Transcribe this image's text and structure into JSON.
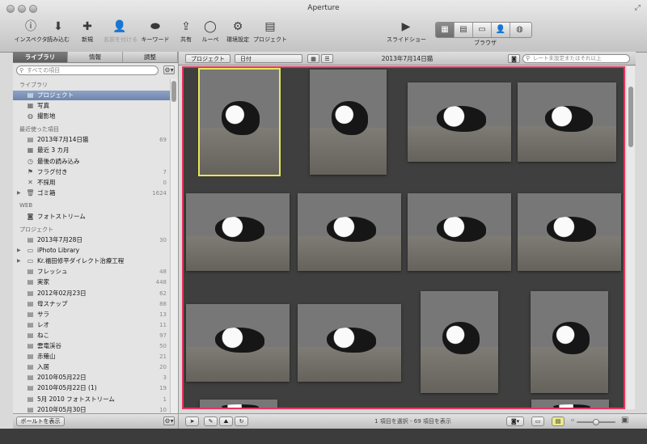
{
  "window": {
    "title": "Aperture"
  },
  "toolbar": {
    "left": [
      {
        "label": "インスペクタ",
        "icon": "inspector-icon",
        "glyph": "ⓘ"
      },
      {
        "label": "読み込む",
        "icon": "import-icon",
        "glyph": "⬇"
      },
      {
        "label": "新規",
        "icon": "new-icon",
        "glyph": "✚"
      },
      {
        "label": "名前を付ける",
        "icon": "name-faces-icon",
        "glyph": "👤"
      },
      {
        "label": "キーワード",
        "icon": "keyword-icon",
        "glyph": "⬬"
      },
      {
        "label": "共有",
        "icon": "share-icon",
        "glyph": "⇪"
      },
      {
        "label": "ルーペ",
        "icon": "loupe-icon",
        "glyph": "◯"
      },
      {
        "label": "環境設定",
        "icon": "adjust-icon",
        "glyph": "⚙"
      },
      {
        "label": "プロジェクト",
        "icon": "project-icon",
        "glyph": "▤"
      }
    ],
    "slideshow": {
      "label": "スライドショー",
      "icon": "slideshow-icon",
      "glyph": "▶"
    },
    "browser_label": "ブラウザ",
    "view_modes": [
      {
        "icon": "grid-view-icon",
        "glyph": "▦",
        "active": true
      },
      {
        "icon": "split-view-icon",
        "glyph": "▤",
        "active": false
      },
      {
        "icon": "viewer-icon",
        "glyph": "▭",
        "active": false
      },
      {
        "icon": "faces-view-icon",
        "glyph": "👤",
        "active": false
      },
      {
        "icon": "places-view-icon",
        "glyph": "◍",
        "active": false
      }
    ]
  },
  "sidebar": {
    "tabs": [
      {
        "label": "ライブラリ",
        "active": true
      },
      {
        "label": "情報",
        "active": false
      },
      {
        "label": "調整",
        "active": false
      }
    ],
    "search_placeholder": "すべての項目",
    "gear_glyph": "⚙▾",
    "sections": [
      {
        "header": "ライブラリ",
        "items": [
          {
            "label": "プロジェクト",
            "icon": "projects-icon",
            "glyph": "▤",
            "selected": true
          },
          {
            "label": "写真",
            "icon": "photos-icon",
            "glyph": "▦"
          },
          {
            "label": "撮影地",
            "icon": "places-icon",
            "glyph": "◍"
          }
        ]
      },
      {
        "header": "最近使った項目",
        "items": [
          {
            "label": "2013年7月14日猫",
            "icon": "project-item-icon",
            "glyph": "▤",
            "count": "69"
          },
          {
            "label": "最近 3 カ月",
            "icon": "calendar-icon",
            "glyph": "▦"
          },
          {
            "label": "最後の読み込み",
            "icon": "last-import-icon",
            "glyph": "◷"
          },
          {
            "label": "フラグ付き",
            "icon": "flag-icon",
            "glyph": "⚑",
            "count": "7"
          },
          {
            "label": "不採用",
            "icon": "reject-icon",
            "glyph": "✕",
            "count": "0"
          },
          {
            "label": "ゴミ箱",
            "icon": "trash-icon",
            "glyph": "🗑",
            "count": "1624",
            "disclosure": "▶"
          }
        ]
      },
      {
        "header": "WEB",
        "items": [
          {
            "label": "フォトストリーム",
            "icon": "photostream-icon",
            "glyph": "◙"
          }
        ]
      },
      {
        "header": "プロジェクト",
        "items": [
          {
            "label": "2013年7月28日",
            "icon": "project-item-icon",
            "glyph": "▤",
            "count": "30"
          },
          {
            "label": "iPhoto Library",
            "icon": "folder-icon",
            "glyph": "▭",
            "disclosure": "▶"
          },
          {
            "label": "Kr.福田修平ダイレクト治療工程",
            "icon": "folder-icon",
            "glyph": "▭",
            "disclosure": "▶"
          },
          {
            "label": "フレッシュ",
            "icon": "project-item-icon",
            "glyph": "▤",
            "count": "48"
          },
          {
            "label": "実家",
            "icon": "project-item-icon",
            "glyph": "▤",
            "count": "448"
          },
          {
            "label": "2012年02月23日",
            "icon": "project-item-icon",
            "glyph": "▤",
            "count": "62"
          },
          {
            "label": "母スナップ",
            "icon": "project-item-icon",
            "glyph": "▤",
            "count": "88"
          },
          {
            "label": "サラ",
            "icon": "project-item-icon",
            "glyph": "▤",
            "count": "13"
          },
          {
            "label": "レオ",
            "icon": "project-item-icon",
            "glyph": "▤",
            "count": "11"
          },
          {
            "label": "ねこ",
            "icon": "project-item-icon",
            "glyph": "▤",
            "count": "97"
          },
          {
            "label": "雲竜渓谷",
            "icon": "project-item-icon",
            "glyph": "▤",
            "count": "50"
          },
          {
            "label": "赤薙山",
            "icon": "project-item-icon",
            "glyph": "▤",
            "count": "21"
          },
          {
            "label": "入居",
            "icon": "project-item-icon",
            "glyph": "▤",
            "count": "20"
          },
          {
            "label": "2010年05月22日",
            "icon": "project-item-icon",
            "glyph": "▤",
            "count": "3"
          },
          {
            "label": "2010年05月22日 (1)",
            "icon": "project-item-icon",
            "glyph": "▤",
            "count": "19"
          },
          {
            "label": "5月 2010 フォトストリーム",
            "icon": "project-item-icon",
            "glyph": "▤",
            "count": "1"
          },
          {
            "label": "2010年05月30日",
            "icon": "project-item-icon",
            "glyph": "▤",
            "count": "10"
          }
        ]
      }
    ],
    "show_ports_button": "ボールトを表示"
  },
  "browser": {
    "sort_popup": "プロジェクト",
    "date_popup": "日付",
    "title": "2013年7月14日猫",
    "filter_placeholder": "レート未設定またはそれ以上",
    "status": "1 項目を選択 - 69 項目を表示",
    "photo_count_visible": 18
  },
  "colors": {
    "selection_outline": "#e6e55a",
    "grid_border": "#e8345f",
    "sidebar_selected": "#7b90b6"
  }
}
